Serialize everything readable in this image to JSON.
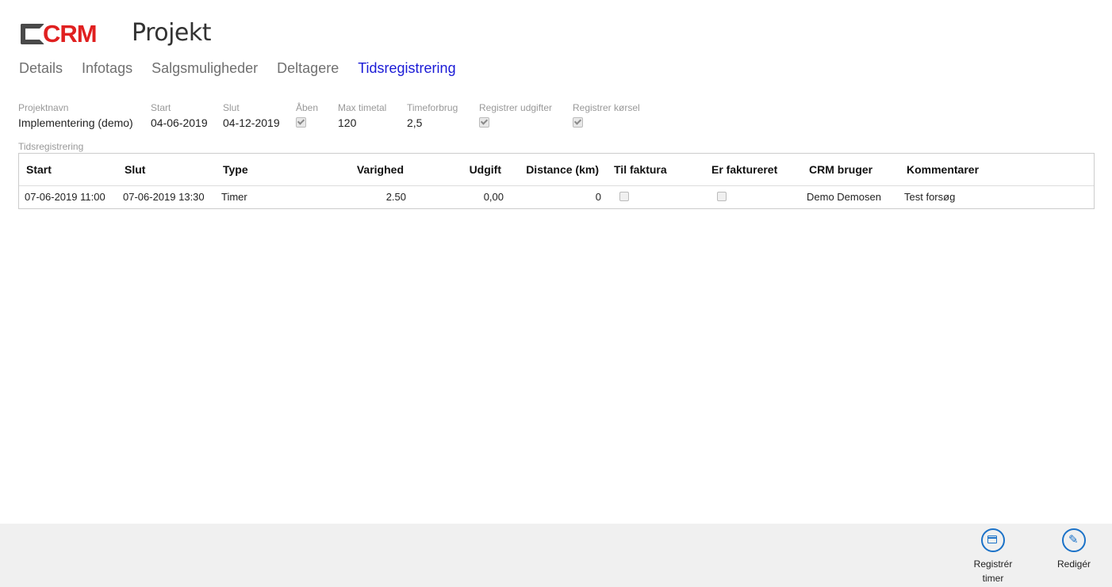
{
  "header": {
    "logo_text": "CRM",
    "title": "Projekt"
  },
  "tabs": [
    {
      "label": "Details",
      "active": false
    },
    {
      "label": "Infotags",
      "active": false
    },
    {
      "label": "Salgsmuligheder",
      "active": false
    },
    {
      "label": "Deltagere",
      "active": false
    },
    {
      "label": "Tidsregistrering",
      "active": true
    }
  ],
  "fields": {
    "projektnavn": {
      "label": "Projektnavn",
      "value": "Implementering (demo)"
    },
    "start": {
      "label": "Start",
      "value": "04-06-2019"
    },
    "slut": {
      "label": "Slut",
      "value": "04-12-2019"
    },
    "aaben": {
      "label": "Åben",
      "checked": true
    },
    "max_timetal": {
      "label": "Max timetal",
      "value": "120"
    },
    "timeforbrug": {
      "label": "Timeforbrug",
      "value": "2,5"
    },
    "registrer_udgifter": {
      "label": "Registrer udgifter",
      "checked": true
    },
    "registrer_koersel": {
      "label": "Registrer kørsel",
      "checked": true
    }
  },
  "section": {
    "label": "Tidsregistrering"
  },
  "grid": {
    "columns": [
      "Start",
      "Slut",
      "Type",
      "Varighed",
      "Udgift",
      "Distance (km)",
      "Til faktura",
      "Er faktureret",
      "CRM bruger",
      "Kommentarer"
    ],
    "rows": [
      {
        "start": "07-06-2019 11:00",
        "slut": "07-06-2019 13:30",
        "type": "Timer",
        "varighed": "2.50",
        "udgift": "0,00",
        "distance": "0",
        "til_faktura": false,
        "er_faktureret": false,
        "crm_bruger": "Demo Demosen",
        "kommentarer": "Test forsøg"
      }
    ]
  },
  "footer": {
    "register_hours": {
      "line1": "Registrér",
      "line2": "timer",
      "icon": "calendar-icon"
    },
    "edit": {
      "label": "Redigér",
      "icon": "pencil-icon"
    }
  },
  "colors": {
    "brand_red": "#e02020",
    "active_tab": "#1a1ad6",
    "action_blue": "#1b72c8"
  }
}
